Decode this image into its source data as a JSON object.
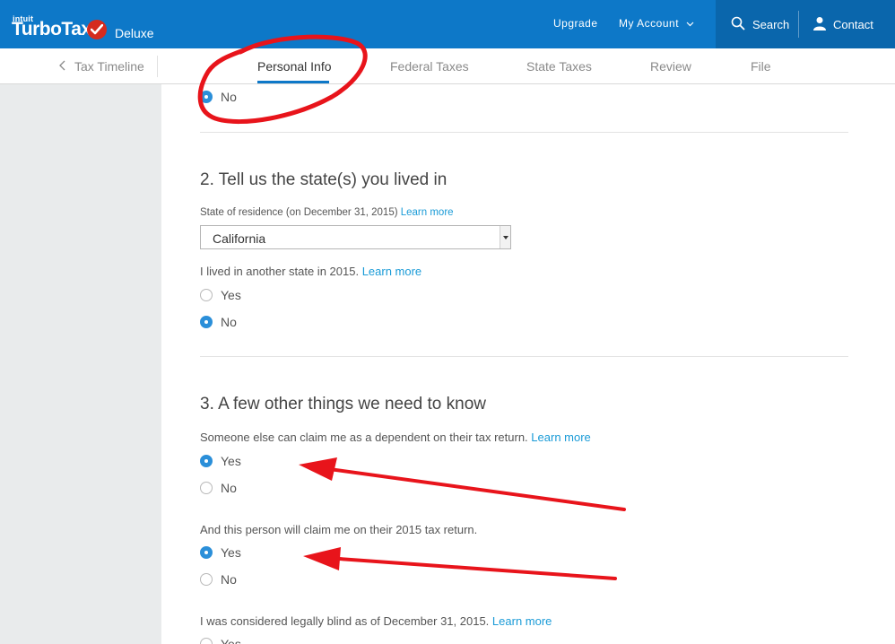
{
  "header": {
    "logo_small": "intuit",
    "logo_main": "TurboTax",
    "edition": "Deluxe",
    "upgrade_label": "Upgrade",
    "account_label": "My Account",
    "search_label": "Search",
    "contact_label": "Contact",
    "brand_color": "#0d78c8",
    "check_color": "#d52b1e"
  },
  "tabs": {
    "timeline_label": "Tax Timeline",
    "items": [
      {
        "label": "Personal Info",
        "active": true
      },
      {
        "label": "Federal Taxes",
        "active": false
      },
      {
        "label": "State Taxes",
        "active": false
      },
      {
        "label": "Review",
        "active": false
      },
      {
        "label": "File",
        "active": false
      }
    ]
  },
  "form": {
    "top_option": {
      "label": "No",
      "checked": true
    },
    "section2": {
      "title": "2. Tell us the state(s) you lived in",
      "residence_label": "State of residence (on December 31, 2015)",
      "residence_link": "Learn more",
      "residence_value": "California",
      "other_state_question": "I lived in another state in 2015.",
      "other_state_link": "Learn more",
      "options": [
        {
          "label": "Yes",
          "checked": false
        },
        {
          "label": "No",
          "checked": true
        }
      ]
    },
    "section3": {
      "title": "3. A few other things we need to know",
      "dependent_question": "Someone else can claim me as a dependent on their tax return.",
      "dependent_link": "Learn more",
      "dependent_options": [
        {
          "label": "Yes",
          "checked": true
        },
        {
          "label": "No",
          "checked": false
        }
      ],
      "claim_question": "And this person will claim me on their 2015 tax return.",
      "claim_options": [
        {
          "label": "Yes",
          "checked": true
        },
        {
          "label": "No",
          "checked": false
        }
      ],
      "blind_question": "I was considered legally blind as of December 31, 2015.",
      "blind_link": "Learn more",
      "blind_first_option": "Yes"
    }
  },
  "annotation_color": "#e8141b"
}
